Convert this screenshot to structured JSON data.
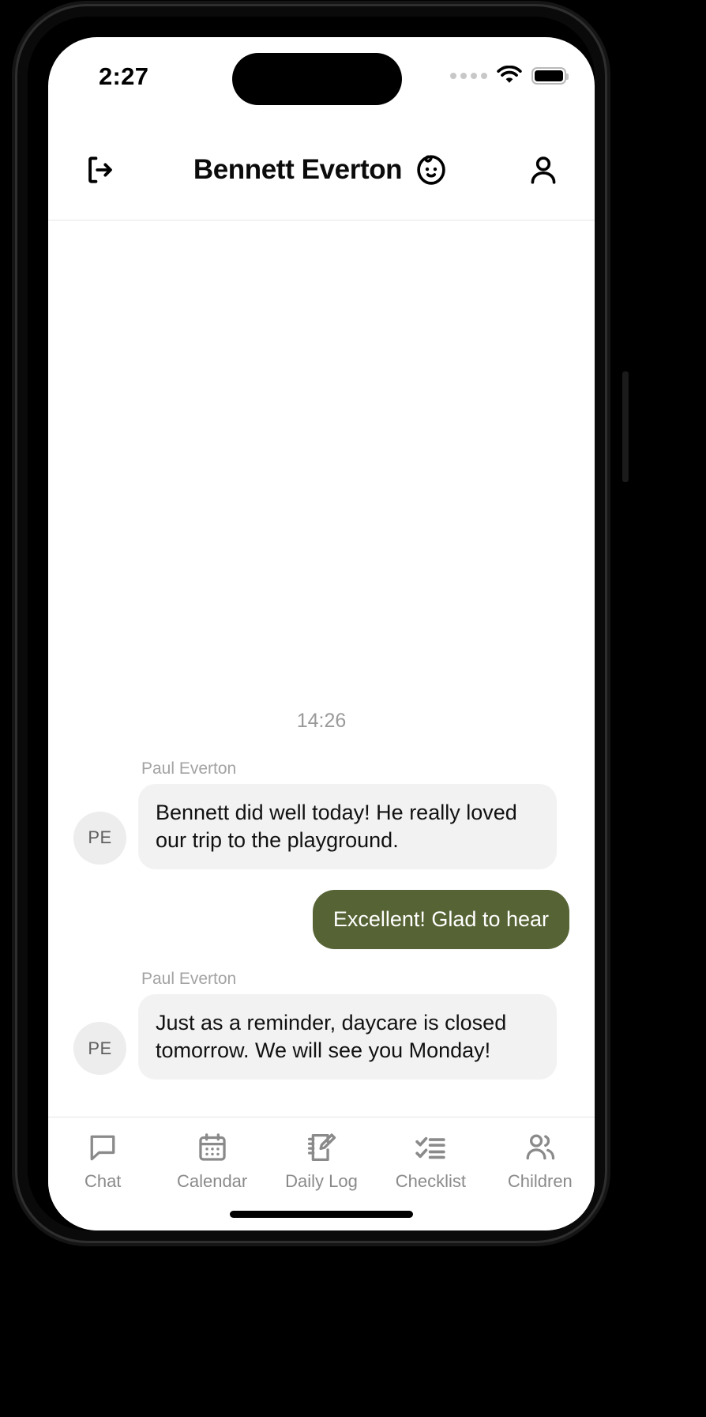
{
  "status_bar": {
    "time": "2:27",
    "signal_icon": "signal-dots-icon",
    "wifi_icon": "wifi-icon",
    "battery_icon": "battery-full-icon"
  },
  "header": {
    "title": "Bennett Everton",
    "logout_icon": "logout-icon",
    "baby_icon": "baby-face-icon",
    "profile_icon": "person-icon"
  },
  "chat": {
    "timestamp": "14:26",
    "messages": [
      {
        "direction": "incoming",
        "sender": "Paul Everton",
        "avatar_initials": "PE",
        "text": "Bennett did well today! He really loved our trip to the playground."
      },
      {
        "direction": "outgoing",
        "sender": "",
        "avatar_initials": "",
        "text": "Excellent! Glad to hear"
      },
      {
        "direction": "incoming",
        "sender": "Paul Everton",
        "avatar_initials": "PE",
        "text": "Just as a reminder, daycare is closed tomorrow. We will see you Monday!"
      }
    ]
  },
  "composer": {
    "value": "",
    "placeholder": ""
  },
  "bottom_nav": {
    "items": [
      {
        "label": "Chat",
        "icon": "chat-bubble-icon"
      },
      {
        "label": "Calendar",
        "icon": "calendar-icon"
      },
      {
        "label": "Daily Log",
        "icon": "notebook-pencil-icon"
      },
      {
        "label": "Checklist",
        "icon": "checklist-icon"
      },
      {
        "label": "Children",
        "icon": "people-icon"
      }
    ]
  },
  "colors": {
    "accent_green": "#566334",
    "input_border_green": "#8dab55",
    "incoming_bubble": "#f2f2f2",
    "muted_text": "#9a9a9a"
  }
}
